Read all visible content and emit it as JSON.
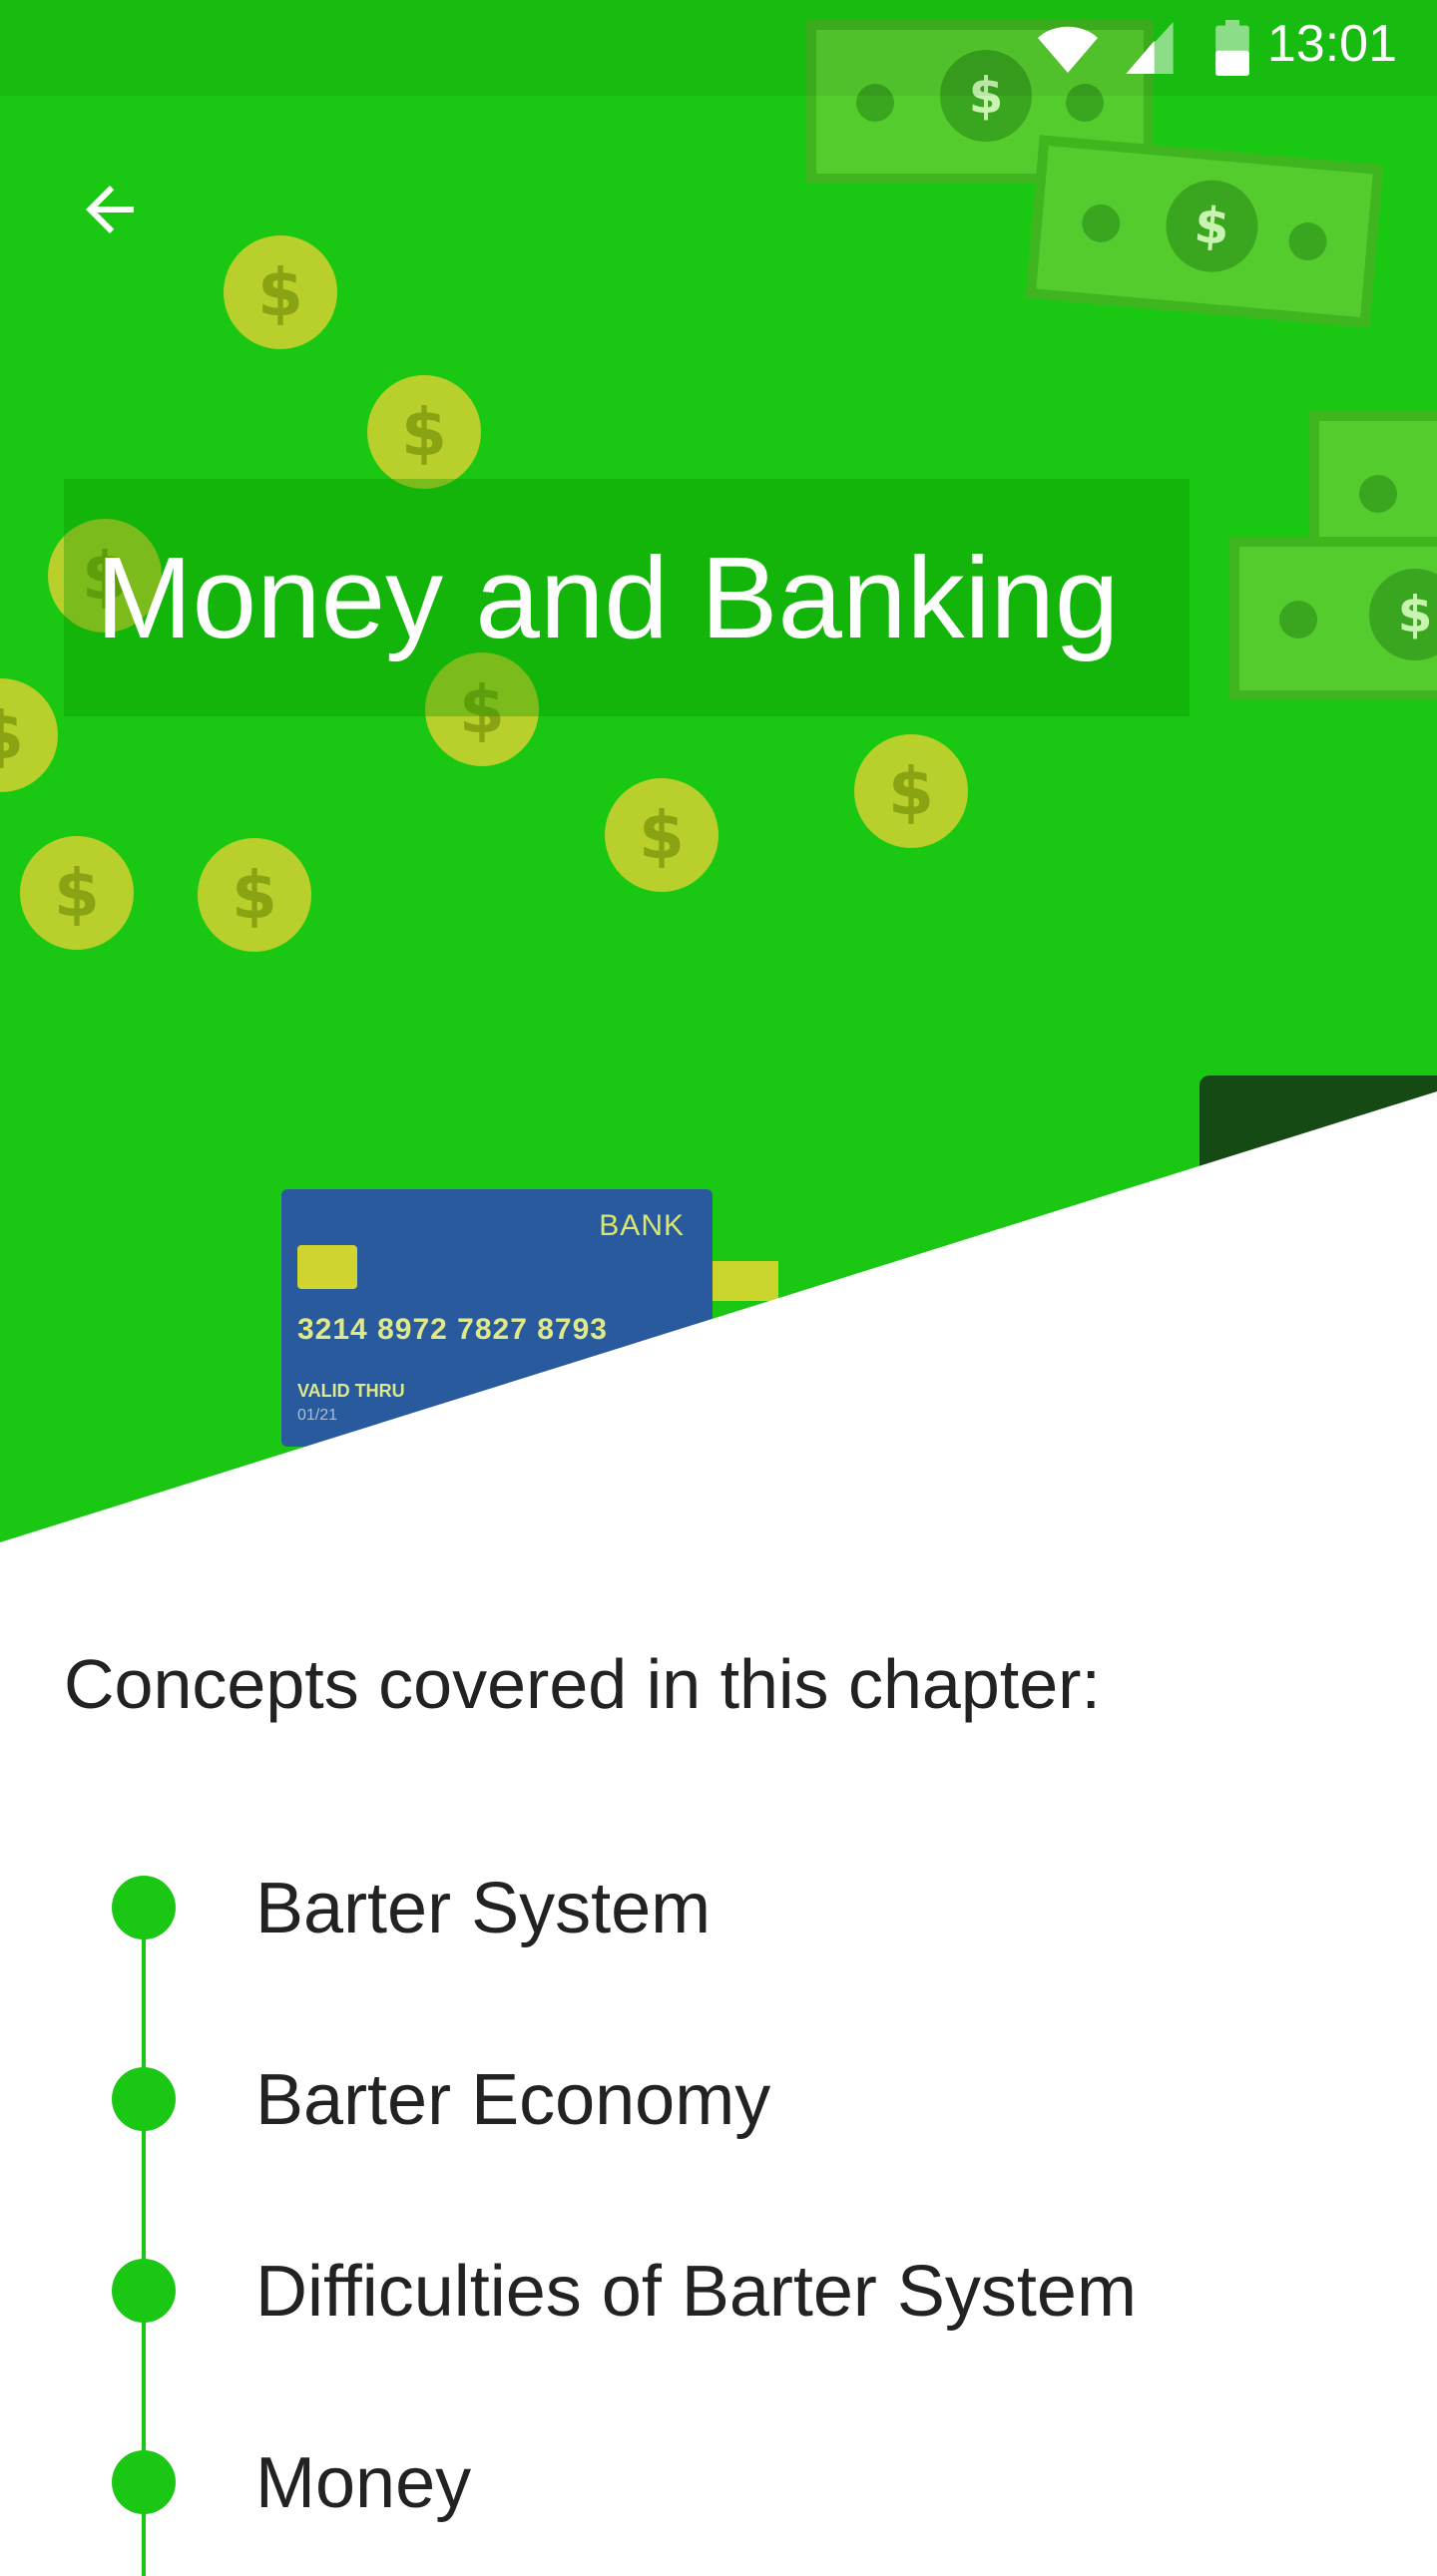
{
  "status_bar": {
    "time": "13:01",
    "icons": [
      "wifi-icon",
      "signal-icon",
      "battery-icon"
    ]
  },
  "header": {
    "back_icon": "arrow-left-icon",
    "title": "Money and Banking"
  },
  "illustration": {
    "coin_symbol": "$",
    "card": {
      "bank": "BANK",
      "number": "3214 8972 7827 8793",
      "valid_label": "VALID THRU",
      "valid_date": "01/21"
    }
  },
  "concepts": {
    "heading": "Concepts covered in this chapter:",
    "items": [
      {
        "label": "Barter System"
      },
      {
        "label": "Barter Economy"
      },
      {
        "label": "Difficulties of Barter System"
      },
      {
        "label": "Money"
      }
    ]
  },
  "colors": {
    "accent": "#1ac712",
    "coin": "#b8cf2c",
    "card": "#2a5a9e",
    "text": "#222222"
  }
}
